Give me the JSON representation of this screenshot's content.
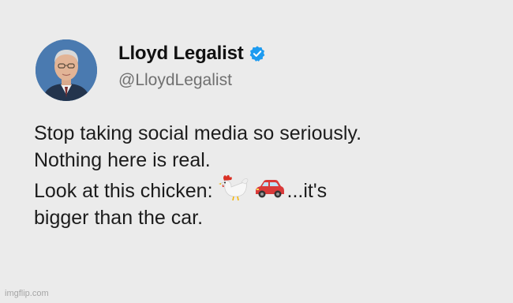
{
  "tweet": {
    "author_name": "Lloyd Legalist",
    "author_handle": "@LloydLegalist",
    "verified": true,
    "lines": {
      "line1": "Stop taking social media so seriously.",
      "line2": "Nothing here is real.",
      "line3_before": "Look at this chicken:",
      "line3_after": "...it's",
      "line4": "bigger than the car."
    },
    "emoji": [
      "chicken-icon",
      "car-icon"
    ]
  },
  "watermark": "imgflip.com",
  "colors": {
    "background": "#ebebeb",
    "verified_badge": "#1d9bf0",
    "handle_text": "#707070"
  }
}
